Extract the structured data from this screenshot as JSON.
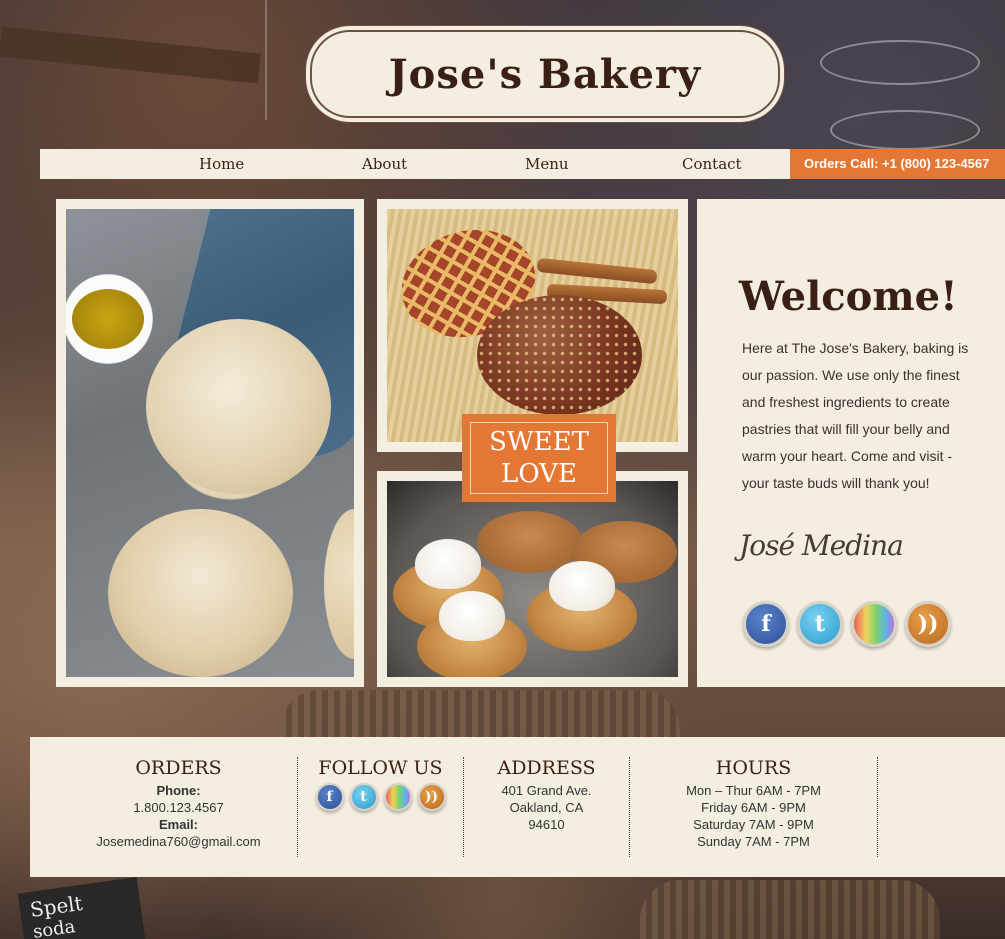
{
  "header": {
    "title": "Jose's Bakery"
  },
  "nav": {
    "items": [
      {
        "label": "Home"
      },
      {
        "label": "About"
      },
      {
        "label": "Menu"
      },
      {
        "label": "Contact"
      }
    ],
    "orders_call": "Orders Call: +1 (800) 123-4567"
  },
  "background": {
    "chalk_text_1": "Spelt",
    "chalk_text_2": "soda"
  },
  "badge": {
    "line1": "SWEET",
    "line2": "LOVE"
  },
  "welcome": {
    "title": "Welcome!",
    "text": "Here at The Jose's Bakery, baking is our passion. We use only the finest and freshest ingredients to create pastries that will fill your belly and warm your heart. Come and visit - your taste buds will thank you!",
    "signature": "José Medina"
  },
  "social": [
    {
      "name": "facebook-icon",
      "glyph": "f"
    },
    {
      "name": "twitter-icon",
      "glyph": "t"
    },
    {
      "name": "flickr-icon",
      "glyph": ""
    },
    {
      "name": "rss-icon",
      "glyph": "))"
    }
  ],
  "footer": {
    "orders": {
      "heading": "ORDERS",
      "phone_label": "Phone:",
      "phone": "1.800.123.4567",
      "email_label": "Email:",
      "email": "Josemedina760@gmail.com"
    },
    "follow": {
      "heading": "FOLLOW US"
    },
    "address": {
      "heading": "ADDRESS",
      "line1": "401 Grand Ave.",
      "line2": "Oakland, CA",
      "line3": "94610"
    },
    "hours": {
      "heading": "HOURS",
      "line1": "Mon – Thur 6AM - 7PM",
      "line2": "Friday 6AM - 9PM",
      "line3": "Saturday 7AM - 9PM",
      "line4": "Sunday 7AM - 7PM"
    }
  },
  "colors": {
    "accent": "#e57734",
    "panel": "#f4eee0",
    "heading": "#3a1f16"
  }
}
